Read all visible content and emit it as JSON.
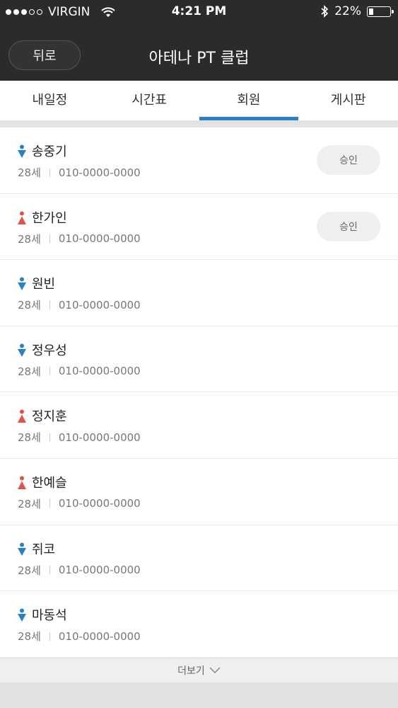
{
  "status_bar": {
    "carrier": "VIRGIN",
    "time": "4:21 PM",
    "battery": "22%",
    "battery_level": 0.22,
    "signal_bars": 3,
    "signal_total": 5
  },
  "nav": {
    "back_label": "뒤로",
    "title": "아테나 PT 클럽"
  },
  "tabs": [
    {
      "label": "내일정",
      "active": false
    },
    {
      "label": "시간표",
      "active": false
    },
    {
      "label": "회원",
      "active": true
    },
    {
      "label": "게시판",
      "active": false
    }
  ],
  "members": [
    {
      "name": "송중기",
      "gender": "male",
      "age": "28세",
      "phone": "010-0000-0000",
      "approve_label": "승인"
    },
    {
      "name": "한가인",
      "gender": "female",
      "age": "28세",
      "phone": "010-0000-0000",
      "approve_label": "승인"
    },
    {
      "name": "원빈",
      "gender": "male",
      "age": "28세",
      "phone": "010-0000-0000",
      "approve_label": null
    },
    {
      "name": "정우성",
      "gender": "male",
      "age": "28세",
      "phone": "010-0000-0000",
      "approve_label": null
    },
    {
      "name": "정지훈",
      "gender": "female",
      "age": "28세",
      "phone": "010-0000-0000",
      "approve_label": null
    },
    {
      "name": "한예슬",
      "gender": "female",
      "age": "28세",
      "phone": "010-0000-0000",
      "approve_label": null
    },
    {
      "name": "쥐코",
      "gender": "male",
      "age": "28세",
      "phone": "010-0000-0000",
      "approve_label": null
    },
    {
      "name": "마동석",
      "gender": "male",
      "age": "28세",
      "phone": "010-0000-0000",
      "approve_label": null
    }
  ],
  "more_label": "더보기",
  "colors": {
    "male": "#2a80c4",
    "female": "#e0524a",
    "accent": "#2a80c4",
    "header_bg": "#2b2b2b"
  },
  "icons": {
    "male": "male-person-icon",
    "female": "female-person-icon",
    "more": "chevron-down-icon",
    "wifi": "wifi-icon",
    "bluetooth": "bluetooth-icon",
    "battery": "battery-icon"
  }
}
